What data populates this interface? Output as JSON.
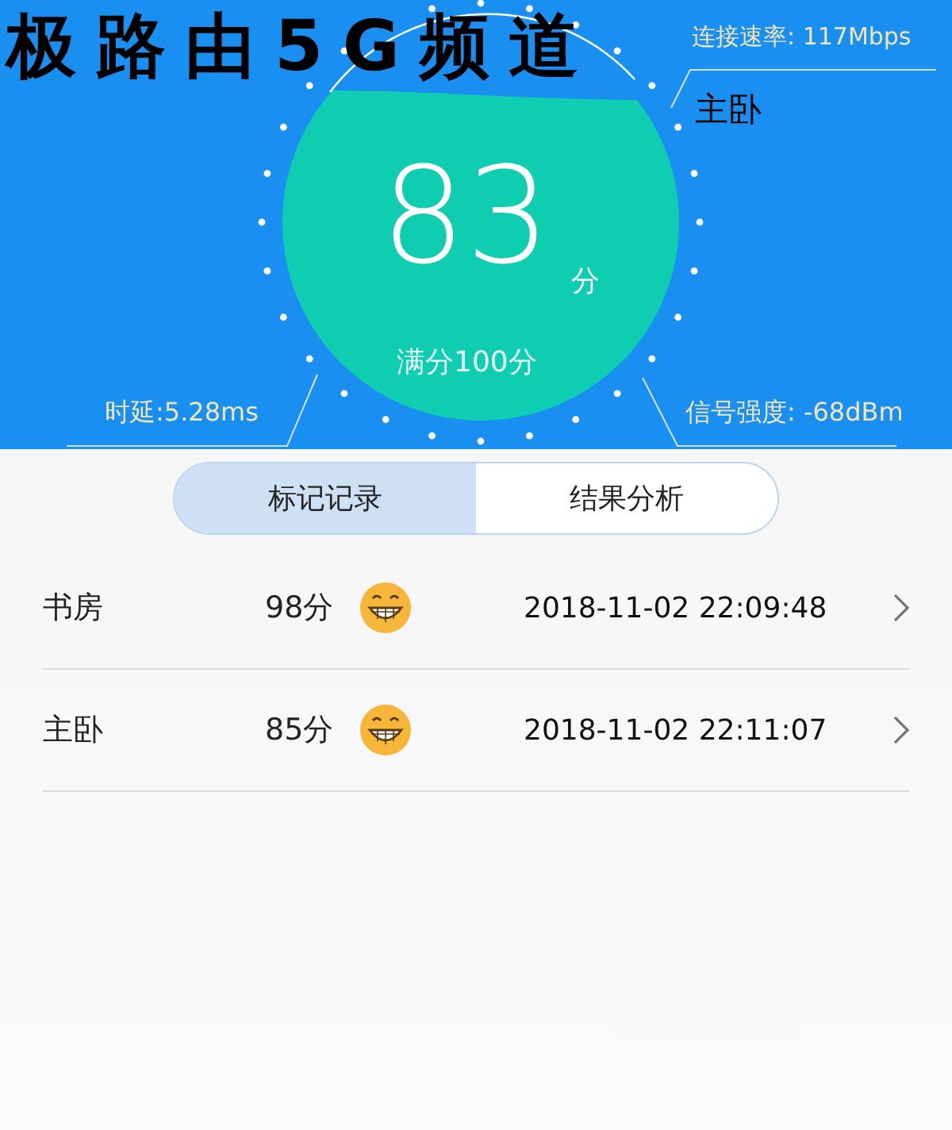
{
  "overlay_title": "极路由5G频道",
  "gauge": {
    "score": "83",
    "unit": "分",
    "full_score": "满分100分",
    "speed": "连接速率: 117Mbps",
    "location": "主卧",
    "latency": "时延:5.28ms",
    "signal": "信号强度: -68dBm"
  },
  "tabs": [
    {
      "label": "标记记录",
      "selected": true
    },
    {
      "label": "结果分析",
      "selected": false
    }
  ],
  "records": [
    {
      "name": "书房",
      "score": "98分",
      "time": "2018-11-02 22:09:48"
    },
    {
      "name": "主卧",
      "score": "85分",
      "time": "2018-11-02 22:11:07"
    }
  ]
}
